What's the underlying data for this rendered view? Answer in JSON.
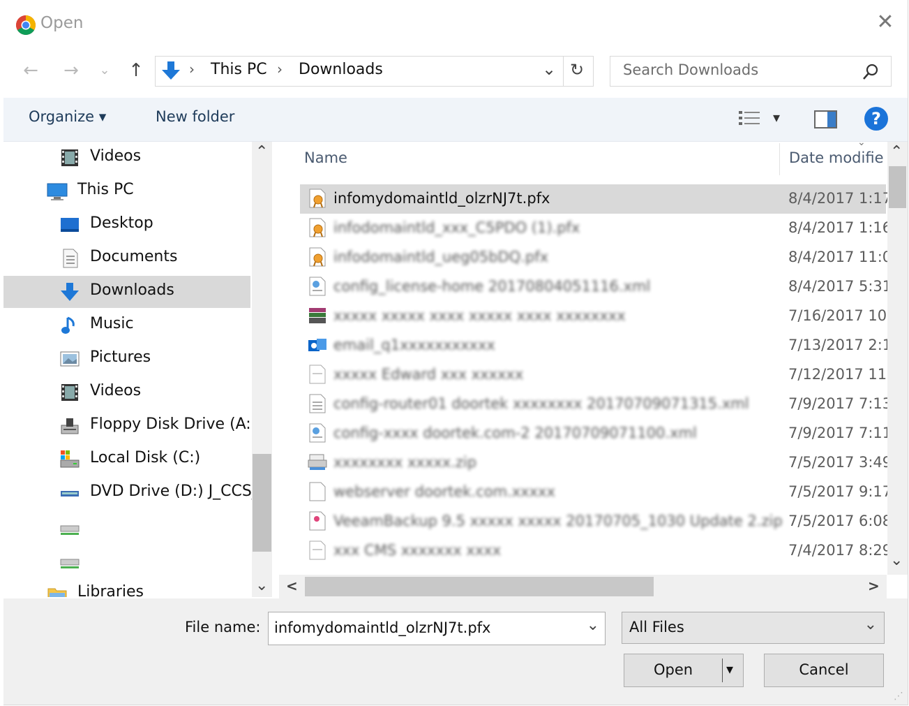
{
  "titlebar": {
    "title": "Open",
    "close_glyph": "✕",
    "app_icon": "chrome-icon"
  },
  "nav": {
    "back_glyph": "←",
    "forward_glyph": "→",
    "recent_glyph": "⌄",
    "up_glyph": "↑",
    "address": {
      "crumbs": [
        "This PC",
        "Downloads"
      ],
      "separator": "›",
      "dropdown_glyph": "⌄",
      "refresh_glyph": "↻"
    },
    "search": {
      "placeholder": "Search Downloads",
      "icon_glyph": "⚲"
    }
  },
  "commandbar": {
    "organize": "Organize ▾",
    "new_folder": "New folder",
    "view_glyph": "▾",
    "help_glyph": "?"
  },
  "navpane": {
    "items": [
      {
        "label": "Videos",
        "icon": "videos-icon",
        "indent": 2
      },
      {
        "label": "This PC",
        "icon": "this-pc-icon",
        "indent": 1
      },
      {
        "label": "Desktop",
        "icon": "desktop-icon",
        "indent": 2
      },
      {
        "label": "Documents",
        "icon": "documents-icon",
        "indent": 2
      },
      {
        "label": "Downloads",
        "icon": "downloads-icon",
        "indent": 2,
        "selected": true
      },
      {
        "label": "Music",
        "icon": "music-icon",
        "indent": 2
      },
      {
        "label": "Pictures",
        "icon": "pictures-icon",
        "indent": 2
      },
      {
        "label": "Videos",
        "icon": "videos-icon",
        "indent": 2
      },
      {
        "label": "Floppy Disk Drive (A:)",
        "icon": "floppy-drive-icon",
        "indent": 2
      },
      {
        "label": "Local Disk (C:)",
        "icon": "local-disk-icon",
        "indent": 2
      },
      {
        "label": "DVD Drive (D:) J_CCS_X",
        "icon": "dvd-drive-icon",
        "indent": 2
      },
      {
        "label": "",
        "icon": "network-drive-icon",
        "indent": 2
      },
      {
        "label": "",
        "icon": "network-drive-icon",
        "indent": 2
      },
      {
        "label": "Libraries",
        "icon": "libraries-icon",
        "indent": 1
      }
    ],
    "scroll_up_glyph": "⌃",
    "scroll_down_glyph": "⌄"
  },
  "filelist": {
    "columns": {
      "name": "Name",
      "date": "Date modifie",
      "sort_glyph": "⌄"
    },
    "rows": [
      {
        "name": "infomydomaintld_olzrNJ7t.pfx",
        "date": "8/4/2017 1:17",
        "icon": "certificate-icon",
        "selected": true,
        "blurred": false
      },
      {
        "name": "infodomaintld_xxx_C5PDO (1).pfx",
        "date": "8/4/2017 1:16",
        "icon": "certificate-icon",
        "blurred": true
      },
      {
        "name": "infodomaintld_ueg05bDQ.pfx",
        "date": "8/4/2017 11:0",
        "icon": "certificate-icon",
        "blurred": true
      },
      {
        "name": "config_license-home 20170804051116.xml",
        "date": "8/4/2017 5:31",
        "icon": "config-file-icon",
        "blurred": true
      },
      {
        "name": "xxxxx xxxxx xxxx xxxxx xxxx xxxxxxxx",
        "date": "7/16/2017 10:",
        "icon": "archive-icon",
        "blurred": true
      },
      {
        "name": "email_q1xxxxxxxxxxx",
        "date": "7/13/2017 2:1",
        "icon": "outlook-icon",
        "blurred": true
      },
      {
        "name": "xxxxx Edward xxx xxxxxx",
        "date": "7/12/2017 11:",
        "icon": "generic-file-icon",
        "blurred": true
      },
      {
        "name": "config-router01 doortek xxxxxxxx 20170709071315.xml",
        "date": "7/9/2017 7:13",
        "icon": "text-file-icon",
        "blurred": true
      },
      {
        "name": "config-xxxx doortek.com-2 20170709071100.xml",
        "date": "7/9/2017 7:11",
        "icon": "config-file-icon",
        "blurred": true
      },
      {
        "name": "xxxxxxxx xxxxx.zip",
        "date": "7/5/2017 3:49",
        "icon": "printer-file-icon",
        "blurred": true
      },
      {
        "name": "webserver doortek.com.xxxxx",
        "date": "7/5/2017 9:17",
        "icon": "blank-file-icon",
        "blurred": true
      },
      {
        "name": "VeeamBackup 9.5 xxxxx xxxxx 20170705_1030 Update 2.zip",
        "date": "7/5/2017 6:08",
        "icon": "veeam-icon",
        "blurred": true
      },
      {
        "name": "xxx CMS xxxxxxx xxxx",
        "date": "7/4/2017 8:29",
        "icon": "generic-file-icon",
        "blurred": true
      }
    ],
    "scroll_up_glyph": "⌃",
    "scroll_down_glyph": "⌄",
    "scroll_left_glyph": "<",
    "scroll_right_glyph": ">"
  },
  "footer": {
    "file_name_label": "File name:",
    "file_name_value": "infomydomaintld_olzrNJ7t.pfx",
    "file_name_dropdown_glyph": "⌄",
    "file_type_value": "All Files",
    "file_type_dropdown_glyph": "⌄",
    "open_label": "Open",
    "open_split_glyph": "▾",
    "cancel_label": "Cancel",
    "grip_glyph": "⋰"
  }
}
